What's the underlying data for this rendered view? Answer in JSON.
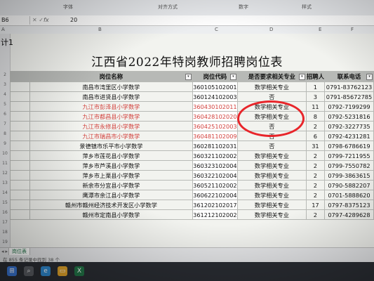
{
  "ribbon": {
    "groups": [
      "字体",
      "对齐方式",
      "数字",
      "样式"
    ]
  },
  "formula_bar": {
    "name_box": "B6",
    "value": "20"
  },
  "columns": [
    "A",
    "B",
    "C",
    "D",
    "E",
    "F"
  ],
  "cell_a1": "计1",
  "sheet_title": "江西省2022年特岗教师招聘岗位表",
  "headers": {
    "post": "岗位名称",
    "code": "岗位代码",
    "req": "是否要求相关专业",
    "count": "招聘人",
    "phone": "联系电话"
  },
  "rows": [
    {
      "post": "南昌市湾里区小学数学",
      "code": "360105102001",
      "req": "数学相关专业",
      "count": "1",
      "phone": "0791-83762123",
      "red": false
    },
    {
      "post": "南昌市进贤县小学数学",
      "code": "360124102003",
      "req": "否",
      "count": "3",
      "phone": "0791-85672785",
      "red": false
    },
    {
      "post": "九江市彭泽县小学数学",
      "code": "360430102011",
      "req": "数学相关专业",
      "count": "11",
      "phone": "0792-7199299",
      "red": true
    },
    {
      "post": "九江市都昌县小学数学",
      "code": "360428102020",
      "req": "数学相关专业",
      "count": "8",
      "phone": "0792-5231816",
      "red": true
    },
    {
      "post": "九江市永修县小学数学",
      "code": "360425102003",
      "req": "否",
      "count": "2",
      "phone": "0792-3227735",
      "red": true
    },
    {
      "post": "九江市瑞昌市小学数学",
      "code": "360481102009",
      "req": "否",
      "count": "6",
      "phone": "0792-4231281",
      "red": true
    },
    {
      "post": "景德镇市乐平市小学数学",
      "code": "360281102031",
      "req": "否",
      "count": "31",
      "phone": "0798-6786619",
      "red": false
    },
    {
      "post": "萍乡市莲花县小学数学",
      "code": "360321102002",
      "req": "数学相关专业",
      "count": "2",
      "phone": "0799-7211955",
      "red": false
    },
    {
      "post": "萍乡市芦溪县小学数学",
      "code": "360323102004",
      "req": "数学相关专业",
      "count": "2",
      "phone": "0799-7550782",
      "red": false
    },
    {
      "post": "萍乡市上栗县小学数学",
      "code": "360322102004",
      "req": "数学相关专业",
      "count": "2",
      "phone": "0799-3863615",
      "red": false
    },
    {
      "post": "新余市分宜县小学数学",
      "code": "360521102002",
      "req": "数学相关专业",
      "count": "2",
      "phone": "0790-5882207",
      "red": false
    },
    {
      "post": "鹰潭市余江县小学数学",
      "code": "360622102004",
      "req": "数学相关专业",
      "count": "2",
      "phone": "0701-5888620",
      "red": false
    },
    {
      "post": "赣州市赣州经济技术开发区小学数学",
      "code": "361202102017",
      "req": "数学相关专业",
      "count": "17",
      "phone": "0797-8375123",
      "red": false
    },
    {
      "post": "赣州市定南县小学数学",
      "code": "361212102002",
      "req": "数学相关专业",
      "count": "2",
      "phone": "0797-4289628",
      "red": false
    }
  ],
  "row_numbers": [
    "2",
    "3",
    "4",
    "5",
    "6",
    "7",
    "8",
    "9",
    "10",
    "11",
    "12",
    "13",
    "14",
    "15",
    "16",
    "17",
    "18",
    "19",
    "20",
    "21",
    "22"
  ],
  "sheet_tab": "岗位表",
  "status_text": "在 855 条记录中找到 38 个"
}
